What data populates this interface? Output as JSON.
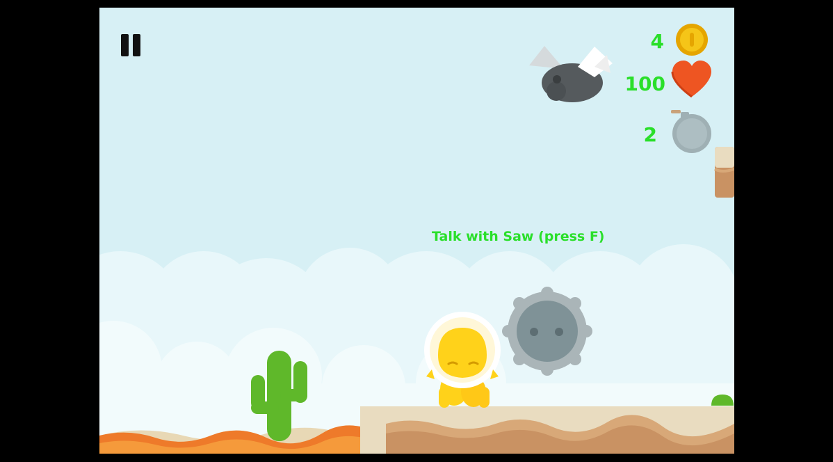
{
  "hud": {
    "coins": "4",
    "health": "100",
    "bombs": "2"
  },
  "prompt": {
    "text": "Talk with Saw (press F)"
  },
  "icons": {
    "pause": "pause-icon",
    "coin": "coin-icon",
    "heart": "heart-icon",
    "bomb": "bomb-icon"
  },
  "colors": {
    "hud_text": "#2adf2a",
    "sky": "#d7f0f5",
    "heart": "#ee5522",
    "coin": "#f5c518",
    "player": "#ffd21a",
    "saw": "#8f9ea3",
    "cactus": "#5fb82a"
  }
}
